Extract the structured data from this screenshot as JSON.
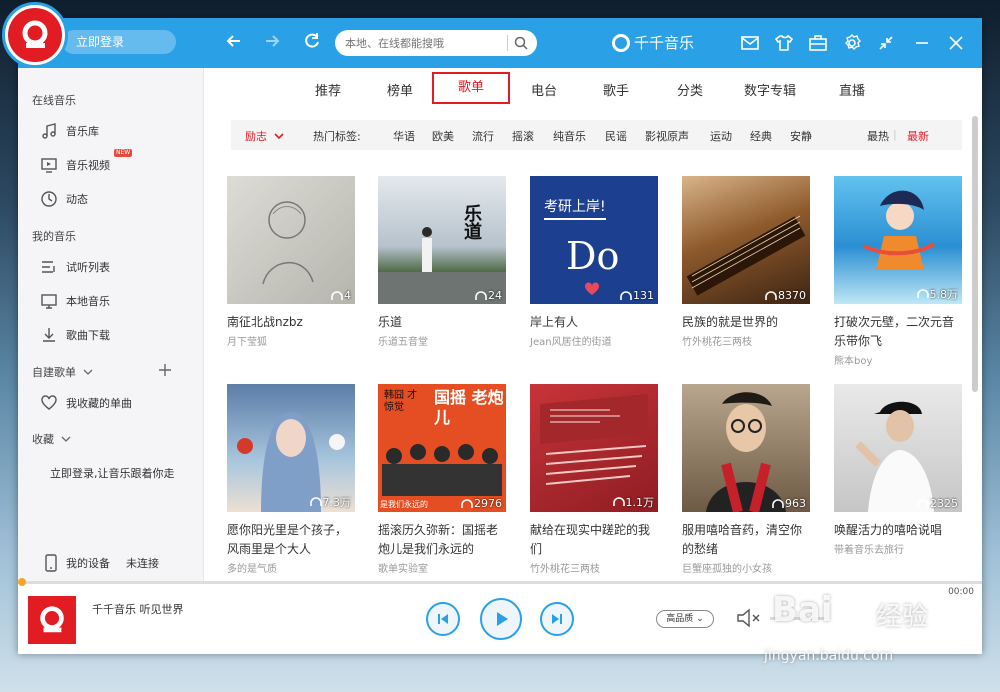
{
  "titlebar": {
    "login": "立即登录",
    "search_placeholder": "本地、在线都能搜哦",
    "brand": "千千音乐"
  },
  "sidebar": {
    "online_section": "在线音乐",
    "online_items": [
      {
        "label": "音乐库"
      },
      {
        "label": "音乐视频",
        "badge": "NEW"
      },
      {
        "label": "动态"
      }
    ],
    "mine_section": "我的音乐",
    "mine_items": [
      {
        "label": "试听列表"
      },
      {
        "label": "本地音乐"
      },
      {
        "label": "歌曲下载"
      }
    ],
    "custom_section": "自建歌单",
    "fav_item": "我收藏的单曲",
    "collect_section": "收藏",
    "login_hint": "立即登录,让音乐跟着你走",
    "device_label": "我的设备",
    "device_status": "未连接"
  },
  "tabs": [
    "推荐",
    "榜单",
    "歌单",
    "电台",
    "歌手",
    "分类",
    "数字专辑",
    "直播"
  ],
  "active_tab": "歌单",
  "tagbar": {
    "current": "励志",
    "hot_label": "热门标签:",
    "tags": [
      "华语",
      "欧美",
      "流行",
      "摇滚",
      "纯音乐",
      "民谣",
      "影视原声",
      "运动",
      "经典",
      "安静"
    ],
    "sort_hot": "最热",
    "sort_new": "最新"
  },
  "playlists": [
    {
      "title": "南征北战nzbz",
      "creator": "月下莹狐",
      "plays": "4",
      "cover": "#c9c9c2"
    },
    {
      "title": "乐道",
      "creator": "乐道五音堂",
      "plays": "24",
      "cover": "#7f95a6",
      "cover_text": "乐道"
    },
    {
      "title": "岸上有人",
      "creator": "Jean风居住的街道",
      "plays": "131",
      "cover": "#1a3f8f",
      "cover_text": "考研上岸!",
      "cover_text2": "Do"
    },
    {
      "title": "民族的就是世界的",
      "creator": "竹外桃花三两枝",
      "plays": "8370",
      "cover": "#7a4a22"
    },
    {
      "title": "打破次元壁，二次元音乐带你飞",
      "creator": "熊本boy",
      "plays": "5.8万",
      "cover": "#3b9fd8"
    },
    {
      "title": "愿你阳光里是个孩子，风雨里是个大人",
      "creator": "多的是气质",
      "plays": "7.3万",
      "cover": "#7ea6c9"
    },
    {
      "title": "摇滚历久弥新：国摇老炮儿是我们永远的",
      "creator": "歌单实验室",
      "plays": "2976",
      "cover": "#e24a23",
      "cover_text": "国摇 老炮儿",
      "cover_text2": "韩囧 才惊觉",
      "cover_text3": "是我们永远的"
    },
    {
      "title": "献给在现实中蹉跎的我们",
      "creator": "竹外桃花三两枝",
      "plays": "1.1万",
      "cover": "#b3262a"
    },
    {
      "title": "服用嘻哈音药，清空你的愁绪",
      "creator": "巨蟹座孤独的小女孩",
      "plays": "963",
      "cover": "#8a7258"
    },
    {
      "title": "唤醒活力的嘻哈说唱",
      "creator": "带着音乐去旅行",
      "plays": "2325",
      "cover": "#d9d9d9"
    }
  ],
  "player": {
    "slogan": "千千音乐 听见世界",
    "quality": "高品质",
    "time": "00:00"
  },
  "watermark": {
    "brand": "Bai",
    "brand2": "经验",
    "url": "jingyan.baidu.com"
  }
}
